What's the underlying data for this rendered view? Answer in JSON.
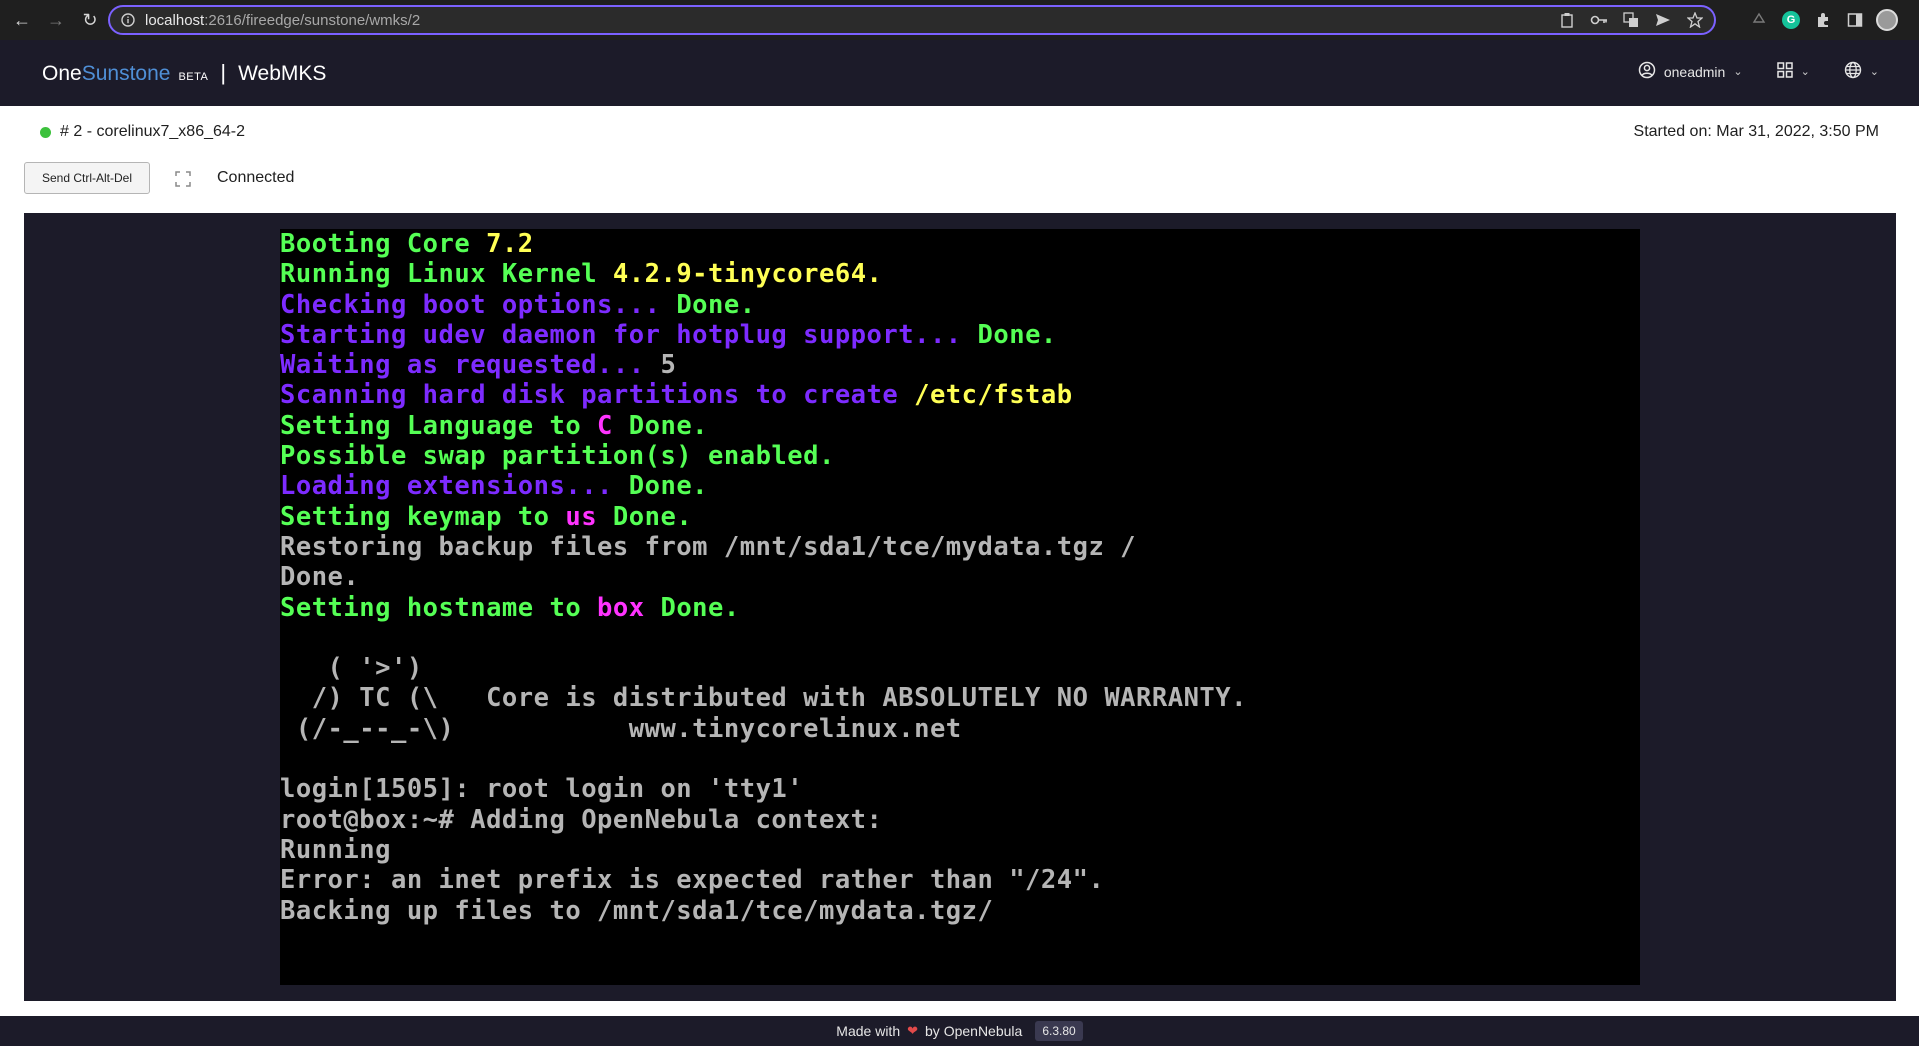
{
  "browser": {
    "url_host": "localhost",
    "url_path": ":2616/fireedge/sunstone/wmks/2"
  },
  "header": {
    "brand_one": "One",
    "brand_sunstone": "Sunstone",
    "brand_beta": "BETA",
    "separator": "|",
    "page_title": "WebMKS",
    "user": "oneadmin"
  },
  "vm": {
    "name": "# 2 - corelinux7_x86_64-2",
    "started": "Started on: Mar 31, 2022, 3:50 PM",
    "status_color": "#3cc13c"
  },
  "controls": {
    "send_cad": "Send Ctrl-Alt-Del",
    "connection_status": "Connected"
  },
  "console": {
    "lines": [
      [
        {
          "t": "Booting Core ",
          "c": "g"
        },
        {
          "t": "7.2",
          "c": "y"
        }
      ],
      [
        {
          "t": "Running Linux Kernel ",
          "c": "g"
        },
        {
          "t": "4.2.9-tinycore64.",
          "c": "y"
        }
      ],
      [
        {
          "t": "Checking boot options... ",
          "c": "p"
        },
        {
          "t": "Done.",
          "c": "g"
        }
      ],
      [
        {
          "t": "Starting udev daemon for hotplug support... ",
          "c": "p"
        },
        {
          "t": "Done.",
          "c": "g"
        }
      ],
      [
        {
          "t": "Waiting as requested... ",
          "c": "p"
        },
        {
          "t": "5",
          "c": "w"
        }
      ],
      [
        {
          "t": "Scanning hard disk partitions to create ",
          "c": "p"
        },
        {
          "t": "/etc/fstab",
          "c": "y"
        }
      ],
      [
        {
          "t": "Setting Language to ",
          "c": "g"
        },
        {
          "t": "C",
          "c": "m"
        },
        {
          "t": " Done.",
          "c": "g"
        }
      ],
      [
        {
          "t": "Possible swap partition(s) enabled.",
          "c": "g"
        }
      ],
      [
        {
          "t": "Loading extensions... ",
          "c": "p"
        },
        {
          "t": "Done.",
          "c": "g"
        }
      ],
      [
        {
          "t": "Setting keymap to ",
          "c": "g"
        },
        {
          "t": "us",
          "c": "m"
        },
        {
          "t": " Done.",
          "c": "g"
        }
      ],
      [
        {
          "t": "Restoring backup files from /mnt/sda1/tce/mydata.tgz /",
          "c": "w"
        }
      ],
      [
        {
          "t": "Done.",
          "c": "w"
        }
      ],
      [
        {
          "t": "Setting hostname to ",
          "c": "g"
        },
        {
          "t": "box",
          "c": "m"
        },
        {
          "t": " Done.",
          "c": "g"
        }
      ],
      [
        {
          "t": "",
          "c": "w"
        }
      ],
      [
        {
          "t": "   ( '>')",
          "c": "w"
        }
      ],
      [
        {
          "t": "  /) TC (\\   Core is distributed with ABSOLUTELY NO WARRANTY.",
          "c": "w"
        }
      ],
      [
        {
          "t": " (/-_--_-\\)           www.tinycorelinux.net",
          "c": "w"
        }
      ],
      [
        {
          "t": "",
          "c": "w"
        }
      ],
      [
        {
          "t": "login[1505]: root login on 'tty1'",
          "c": "w"
        }
      ],
      [
        {
          "t": "root@box:~# Adding OpenNebula context:",
          "c": "w"
        }
      ],
      [
        {
          "t": "Running",
          "c": "w"
        }
      ],
      [
        {
          "t": "Error: an inet prefix is expected rather than \"/24\".",
          "c": "w"
        }
      ],
      [
        {
          "t": "Backing up files to /mnt/sda1/tce/mydata.tgz/",
          "c": "w"
        }
      ]
    ]
  },
  "footer": {
    "made_with": "Made with",
    "by": "by OpenNebula",
    "version": "6.3.80"
  }
}
